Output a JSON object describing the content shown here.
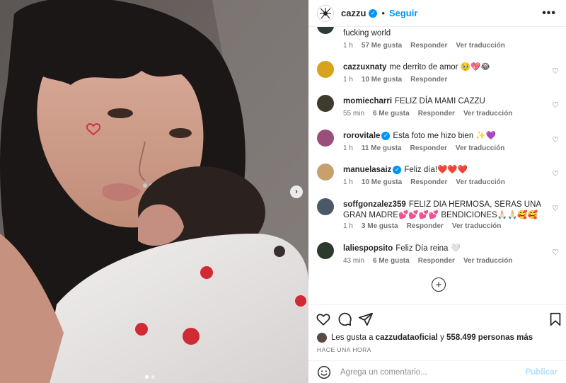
{
  "post": {
    "username": "cazzu",
    "follow_label": "Seguir",
    "separator": "•"
  },
  "comments": [
    {
      "user": "",
      "text": "fucking world",
      "time": "1 h",
      "likes": "57 Me gusta",
      "reply": "Responder",
      "translate": "Ver traducción",
      "avatar_color": "#2f3a3a"
    },
    {
      "user": "cazzuxnaty",
      "text": "me derrito de amor 🥹💖😂",
      "time": "1 h",
      "likes": "10 Me gusta",
      "reply": "Responder",
      "translate": "",
      "avatar_color": "#d9a21c"
    },
    {
      "user": "momiecharri",
      "text": "FELIZ DÍA MAMI CAZZU",
      "time": "55 min",
      "likes": "6 Me gusta",
      "reply": "Responder",
      "translate": "Ver traducción",
      "avatar_color": "#3d3a2e"
    },
    {
      "user": "rorovitale",
      "text": "Esta foto me hizo bien ✨💜",
      "time": "1 h",
      "likes": "11 Me gusta",
      "reply": "Responder",
      "translate": "Ver traducción",
      "avatar_color": "#9a4e7a",
      "verified": true
    },
    {
      "user": "manuelasaiz",
      "text": "Feliz día!❤️❤️❤️",
      "time": "1 h",
      "likes": "10 Me gusta",
      "reply": "Responder",
      "translate": "Ver traducción",
      "avatar_color": "#c8a06d",
      "verified": true
    },
    {
      "user": "soffgonzalez359",
      "text": "FELIZ DIA HERMOSA, SERAS UNA GRAN MADRE💕💕💕💕 BENDICIONES🙏🏻🙏🏻🥰🥰",
      "time": "1 h",
      "likes": "3 Me gusta",
      "reply": "Responder",
      "translate": "Ver traducción",
      "avatar_color": "#4a5868"
    },
    {
      "user": "laliespopsito",
      "text": "Feliz Día reina 🤍",
      "time": "43 min",
      "likes": "6 Me gusta",
      "reply": "Responder",
      "translate": "Ver traducción",
      "avatar_color": "#2c3a2e"
    }
  ],
  "likes_line": {
    "prefix": "Les gusta a",
    "user": "cazzudataoficial",
    "mid": "y",
    "count": "558.499 personas más"
  },
  "timestamp": "HACE UNA HORA",
  "add_comment": {
    "placeholder": "Agrega un comentario...",
    "publish": "Publicar"
  },
  "icons": {
    "more": "more-options-icon",
    "heart": "heart-icon",
    "comment": "comment-icon",
    "share": "share-icon",
    "save": "bookmark-icon",
    "emoji": "emoji-icon",
    "add": "plus-circle-icon",
    "next": "chevron-right-icon"
  },
  "colors": {
    "accent": "#0095f6",
    "publish_disabled": "#b2dffc",
    "muted": "#737373"
  }
}
